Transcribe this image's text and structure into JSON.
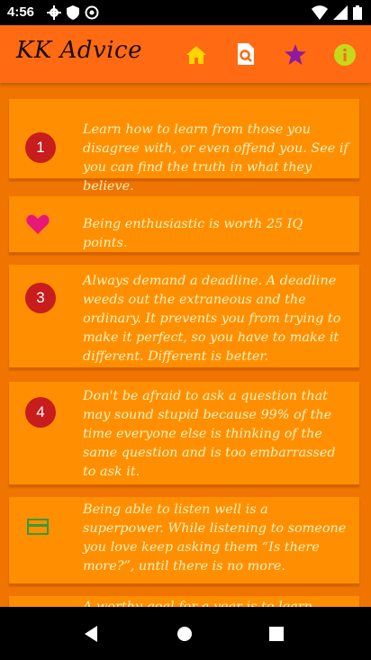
{
  "status_bar": {
    "time": "4:56"
  },
  "app_bar": {
    "title": "KK Advice"
  },
  "advice_items": [
    {
      "marker": "1",
      "text": "Learn how to learn from those you disagree with, or even offend you. See if you can find the truth in what they believe."
    },
    {
      "marker": "heart-icon",
      "text": "Being enthusiastic is worth 25 IQ points."
    },
    {
      "marker": "3",
      "text": "Always demand a deadline. A deadline weeds out the extraneous and the ordinary. It prevents you from trying to make it perfect, so you have to make it different. Different is better."
    },
    {
      "marker": "4",
      "text": "Don't be afraid to ask a question that may sound stupid because 99% of the time everyone else is thinking of the same question and is too embarrassed to ask it."
    },
    {
      "marker": "card-icon",
      "text": "Being able to listen well is a superpower. While listening to someone you love keep asking them “Is there more?”, until there is no more."
    },
    {
      "marker": "",
      "text": "A worthy goal for a year is to learn"
    }
  ],
  "colors": {
    "app_bar": "#ff6a13",
    "background": "#ef7400",
    "card": "#ff8f00",
    "badge": "#c71d1d",
    "card_text": "#fff2bf"
  }
}
